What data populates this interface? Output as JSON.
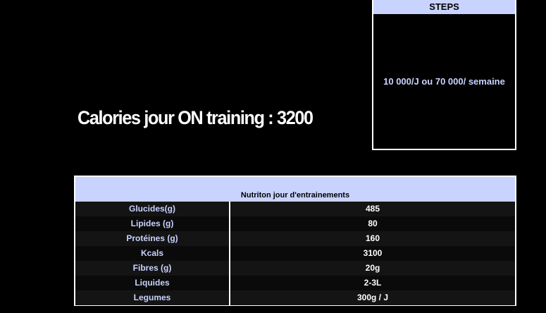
{
  "steps": {
    "header": "STEPS",
    "value": "10 000/J ou 70 000/ semaine"
  },
  "calories": {
    "title": "Calories jour ON training : 3200"
  },
  "nutrition": {
    "header": "Nutriton jour d'entrainements",
    "rows": [
      {
        "label": "Glucides(g)",
        "value": "485"
      },
      {
        "label": "Lipides (g)",
        "value": "80"
      },
      {
        "label": "Protéines (g)",
        "value": "160"
      },
      {
        "label": "Kcals",
        "value": "3100"
      },
      {
        "label": "Fibres (g)",
        "value": "20g"
      },
      {
        "label": "Liquides",
        "value": "2-3L"
      },
      {
        "label": "Legumes",
        "value": "300g / J"
      }
    ]
  },
  "colors": {
    "background": "#000000",
    "header_bg": "#c9d3ff",
    "label_text": "#c9d3ff",
    "value_text": "#ffffff",
    "border": "#ffffff"
  }
}
